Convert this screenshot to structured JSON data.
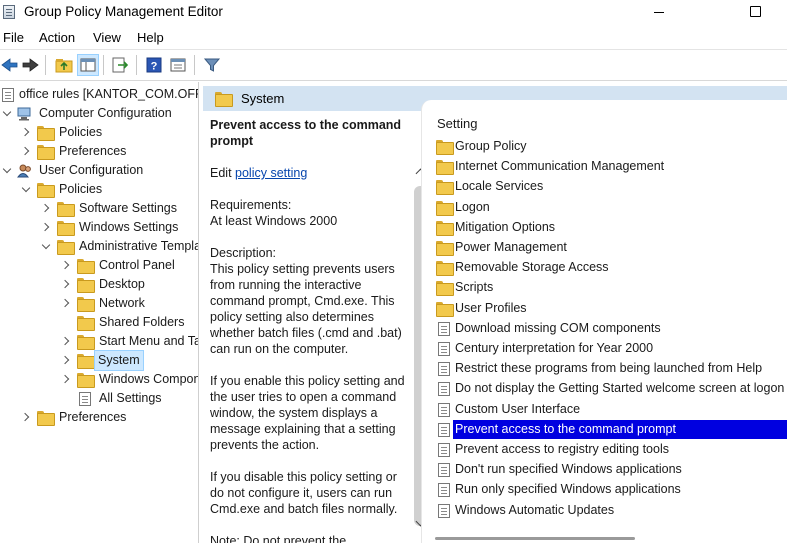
{
  "window": {
    "title": "Group Policy Management Editor"
  },
  "menu": [
    "File",
    "Action",
    "View",
    "Help"
  ],
  "toolbar": {
    "buttons": [
      "back-icon",
      "forward-icon",
      "up-folder-icon",
      "show-hide-tree-icon",
      "export-list-icon",
      "help-icon",
      "properties-icon",
      "filter-icon"
    ]
  },
  "tree": {
    "root": "office rules [KANTOR_COM.OFFICE",
    "computer_configuration": "Computer Configuration",
    "policies": "Policies",
    "preferences": "Preferences",
    "user_configuration": "User Configuration",
    "user_policies": "Policies",
    "software_settings": "Software Settings",
    "windows_settings": "Windows Settings",
    "administrative_templates": "Administrative Templates",
    "control_panel": "Control Panel",
    "desktop": "Desktop",
    "network": "Network",
    "shared_folders": "Shared Folders",
    "start_menu": "Start Menu and Taskbar",
    "system": "System",
    "windows_components": "Windows Components",
    "all_settings": "All Settings",
    "user_preferences": "Preferences"
  },
  "header": {
    "title": "System"
  },
  "description": {
    "title": "Prevent access to the command prompt",
    "edit_prefix": "Edit ",
    "edit_link": "policy setting",
    "requirements_label": "Requirements:",
    "requirements_value": "At least Windows 2000",
    "description_label": "Description:",
    "para1": "This policy setting prevents users from running the interactive command prompt, Cmd.exe.  This policy setting also determines whether batch files (.cmd and .bat) can run on the computer.",
    "para2": "If you enable this policy setting and the user tries to open a command window, the system displays a message explaining that a setting prevents the action.",
    "para3": "If you disable this policy setting or do not configure it, users can run Cmd.exe and batch files normally.",
    "para4": "Note: Do not prevent the"
  },
  "list": {
    "column_header": "Setting",
    "items": [
      {
        "label": "Group Policy",
        "icon": "folder-icon"
      },
      {
        "label": "Internet Communication Management",
        "icon": "folder-icon"
      },
      {
        "label": "Locale Services",
        "icon": "folder-icon"
      },
      {
        "label": "Logon",
        "icon": "folder-icon"
      },
      {
        "label": "Mitigation Options",
        "icon": "folder-icon"
      },
      {
        "label": "Power Management",
        "icon": "folder-icon"
      },
      {
        "label": "Removable Storage Access",
        "icon": "folder-icon"
      },
      {
        "label": "Scripts",
        "icon": "folder-icon"
      },
      {
        "label": "User Profiles",
        "icon": "folder-icon"
      },
      {
        "label": "Download missing COM components",
        "icon": "policy-setting-icon"
      },
      {
        "label": "Century interpretation for Year 2000",
        "icon": "policy-setting-icon"
      },
      {
        "label": "Restrict these programs from being launched from Help",
        "icon": "policy-setting-icon"
      },
      {
        "label": "Do not display the Getting Started welcome screen at logon",
        "icon": "policy-setting-icon"
      },
      {
        "label": "Custom User Interface",
        "icon": "policy-setting-icon"
      },
      {
        "label": "Prevent access to the command prompt",
        "icon": "policy-setting-icon",
        "selected": true
      },
      {
        "label": "Prevent access to registry editing tools",
        "icon": "policy-setting-icon"
      },
      {
        "label": "Don't run specified Windows applications",
        "icon": "policy-setting-icon"
      },
      {
        "label": "Run only specified Windows applications",
        "icon": "policy-setting-icon"
      },
      {
        "label": "Windows Automatic Updates",
        "icon": "policy-setting-icon"
      }
    ]
  },
  "colors": {
    "selection": "#0000e0",
    "header_strip": "#d3e3f2",
    "folder": "#f2c94c",
    "link": "#0645ad"
  }
}
